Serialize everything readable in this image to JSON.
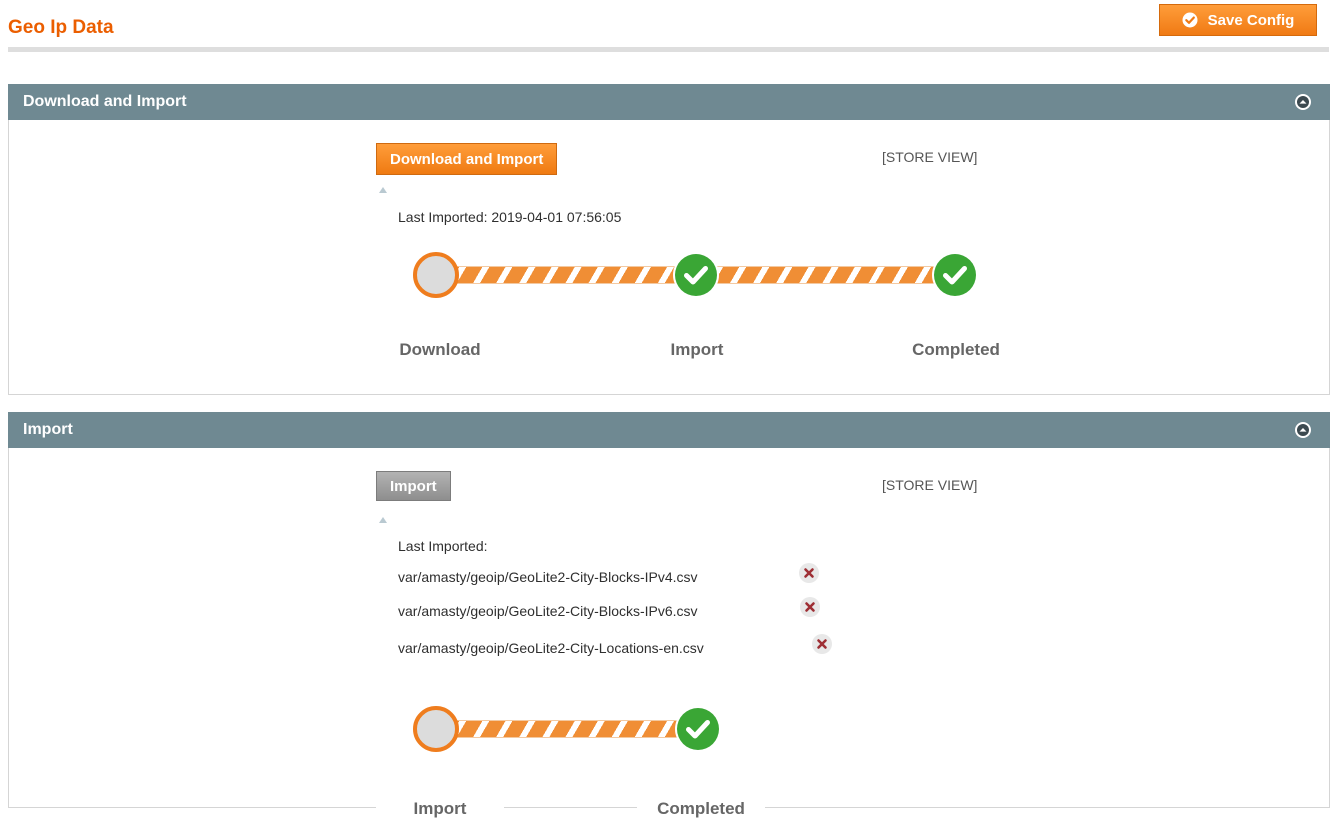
{
  "page": {
    "title": "Geo Ip Data",
    "save_label": "Save Config"
  },
  "colors": {
    "brand_orange": "#eb5e00",
    "section_header": "#6f8992",
    "success_green": "#3aa635",
    "progress_orange": "#f08e35"
  },
  "download_section": {
    "title": "Download and Import",
    "button_label": "Download and Import",
    "scope": "[STORE VIEW]",
    "last_imported": "Last Imported: 2019-04-01 07:56:05",
    "steps": [
      {
        "label": "Download",
        "status": "pending"
      },
      {
        "label": "Import",
        "status": "done"
      },
      {
        "label": "Completed",
        "status": "done"
      }
    ]
  },
  "import_section": {
    "title": "Import",
    "button_label": "Import",
    "scope": "[STORE VIEW]",
    "last_imported_label": "Last Imported:",
    "files": [
      "var/amasty/geoip/GeoLite2-City-Blocks-IPv4.csv",
      "var/amasty/geoip/GeoLite2-City-Blocks-IPv6.csv",
      "var/amasty/geoip/GeoLite2-City-Locations-en.csv"
    ],
    "steps": [
      {
        "label": "Import",
        "status": "pending"
      },
      {
        "label": "Completed",
        "status": "done"
      }
    ]
  },
  "icons": {
    "save": "check-circle-icon",
    "collapse": "chevron-up-circle-icon",
    "remove": "delete-x-icon",
    "step_done": "check-circle-icon",
    "step_pending": "empty-circle-icon"
  }
}
